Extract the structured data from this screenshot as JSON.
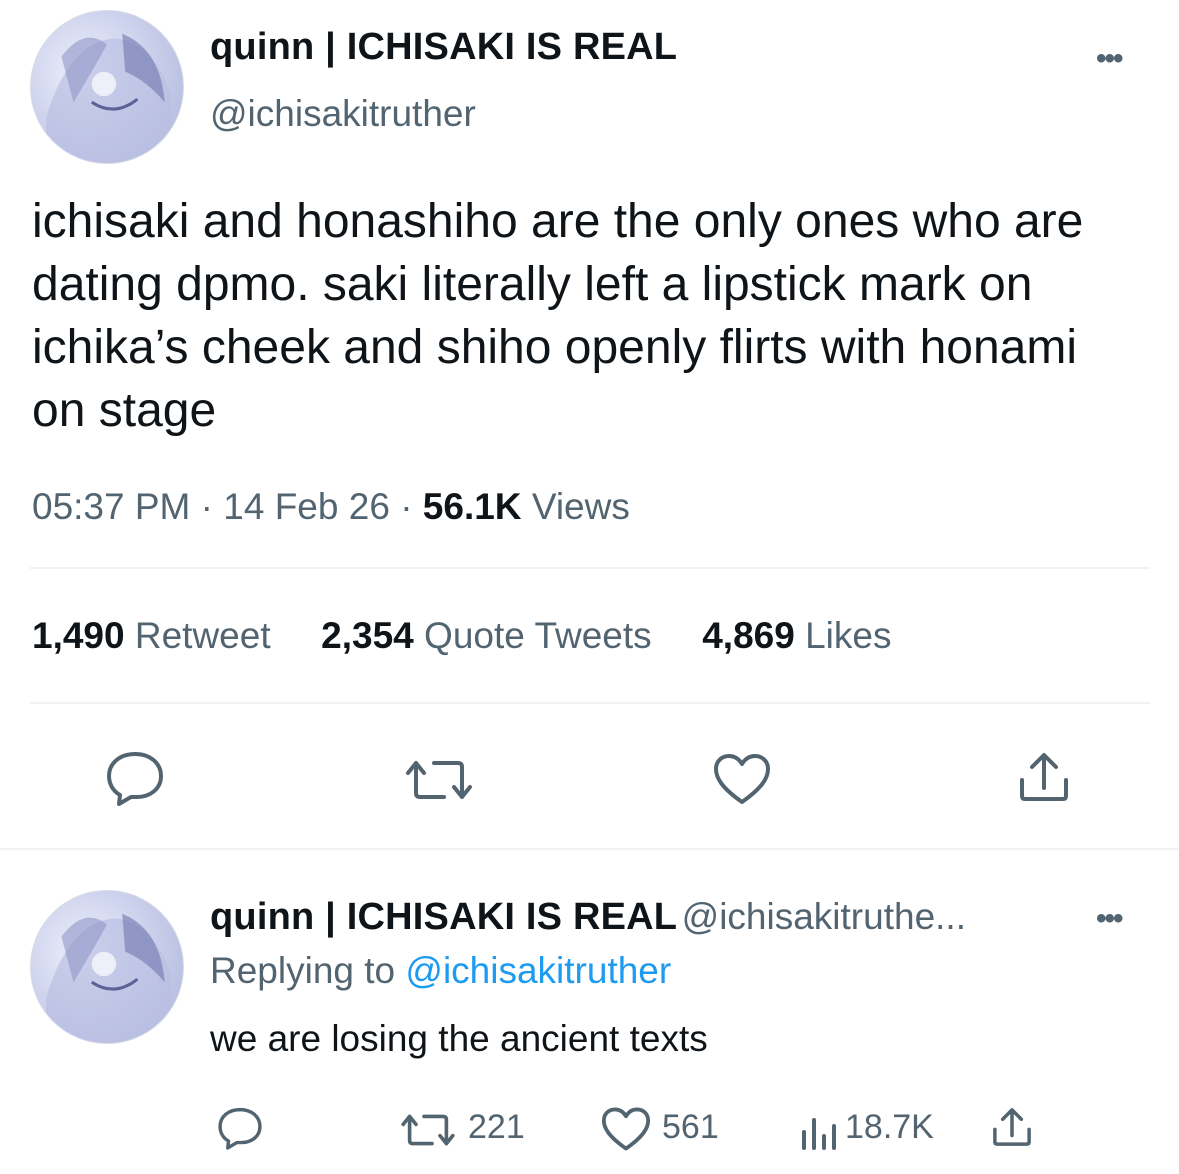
{
  "tweet": {
    "display_name": "quinn | ICHISAKI IS REAL",
    "handle": "@ichisakitruther",
    "more_label": "•••",
    "text": "ichisaki and honashiho are the only ones who are dating dpmo. saki literally left a lipstick mark on ichika’s cheek and shiho openly flirts with honami on stage",
    "time": "05:37 PM",
    "separator": "·",
    "date": "14 Feb 26",
    "views_count": "56.1K",
    "views_label": "Views",
    "retweets_count": "1,490",
    "retweets_label": "Retweet",
    "quotes_count": "2,354",
    "quotes_label": "Quote Tweets",
    "likes_count": "4,869",
    "likes_label": "Likes",
    "icons": [
      "reply-icon",
      "retweet-icon",
      "like-icon",
      "share-icon"
    ]
  },
  "reply": {
    "display_name": "quinn | ICHISAKI IS REAL",
    "handle": "@ichisakitruthe...",
    "more_label": "•••",
    "replying_prefix": "Replying to",
    "replying_mention": "@ichisakitruther",
    "text": "we are losing the ancient texts",
    "retweets": "221",
    "likes": "561",
    "views": "18.7K",
    "icons": [
      "reply-icon",
      "retweet-icon",
      "like-icon",
      "views-icon",
      "share-icon"
    ]
  },
  "colors": {
    "text": "#0f1419",
    "secondary": "#536471",
    "link": "#1d9bf0",
    "divider": "#eff3f4"
  }
}
